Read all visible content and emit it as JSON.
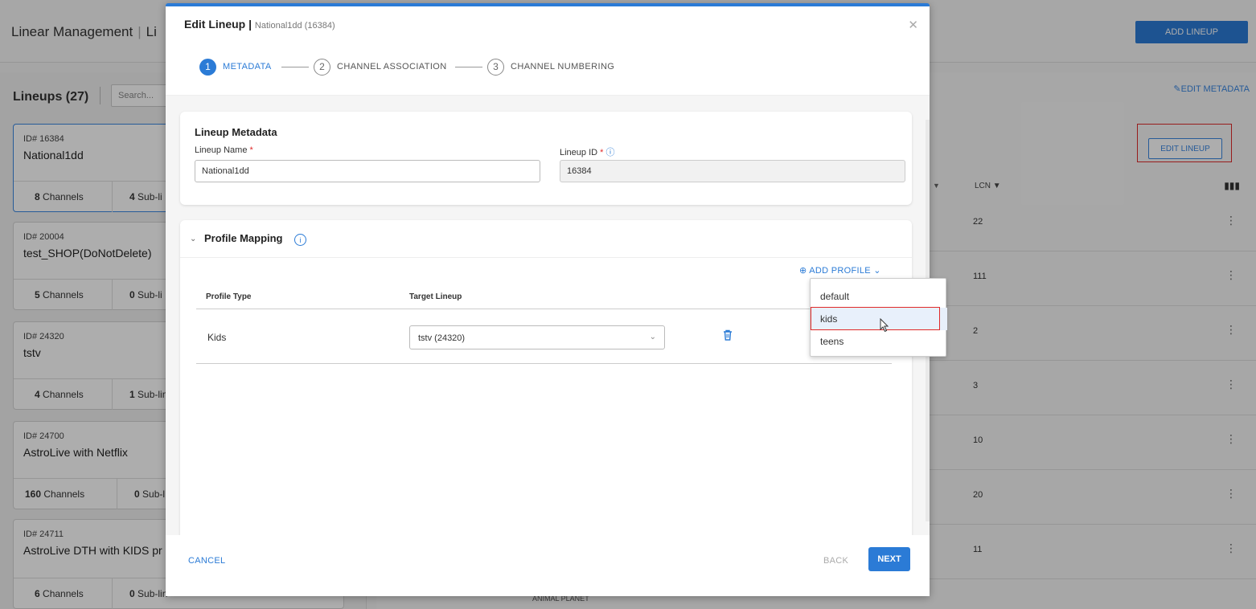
{
  "app": {
    "title": "Linear Management",
    "title_partial": "Li",
    "add_lineup_label": "ADD LINEUP"
  },
  "sidebar": {
    "heading": "Lineups (27)",
    "search_placeholder": "Search...",
    "cards": [
      {
        "id_label": "ID# 16384",
        "name": "National1dd",
        "channels_count": "8",
        "channels_word": "Channels",
        "sub_count": "4",
        "sub_word": "Sub-li"
      },
      {
        "id_label": "ID# 20004",
        "name": "test_SHOP(DoNotDelete)",
        "channels_count": "5",
        "channels_word": "Channels",
        "sub_count": "0",
        "sub_word": "Sub-li"
      },
      {
        "id_label": "ID# 24320",
        "name": "tstv",
        "channels_count": "4",
        "channels_word": "Channels",
        "sub_count": "1",
        "sub_word": "Sub-lin"
      },
      {
        "id_label": "ID# 24700",
        "name": "AstroLive with Netflix",
        "channels_count": "160",
        "channels_word": "Channels",
        "sub_count": "0",
        "sub_word": "Sub-l"
      },
      {
        "id_label": "ID# 24711",
        "name": "AstroLive DTH with KIDS pr",
        "channels_count": "6",
        "channels_word": "Channels",
        "sub_count": "0",
        "sub_word": "Sub-lin"
      }
    ]
  },
  "details": {
    "edit_metadata_label": "EDIT METADATA",
    "edit_lineup_label": "EDIT LINEUP",
    "lcn_header": "LCN",
    "lcn_values": [
      "22",
      "111",
      "2",
      "3",
      "10",
      "20",
      "11"
    ],
    "partial_row_text": "ANIMAL PLANET"
  },
  "modal": {
    "title": "Edit Lineup",
    "subtitle": "National1dd (16384)",
    "steps": [
      {
        "num": "1",
        "label": "METADATA"
      },
      {
        "num": "2",
        "label": "CHANNEL ASSOCIATION"
      },
      {
        "num": "3",
        "label": "CHANNEL NUMBERING"
      }
    ],
    "metadata": {
      "heading": "Lineup Metadata",
      "name_label": "Lineup Name",
      "name_value": "National1dd",
      "id_label": "Lineup ID",
      "id_value": "16384"
    },
    "profile_mapping": {
      "heading": "Profile Mapping",
      "add_profile_label": "ADD PROFILE",
      "col_profile_type": "Profile Type",
      "col_target_lineup": "Target Lineup",
      "rows": [
        {
          "profile_type": "Kids",
          "target_lineup": "tstv (24320)"
        }
      ]
    },
    "footer": {
      "cancel_label": "CANCEL",
      "back_label": "BACK",
      "next_label": "NEXT"
    }
  },
  "profile_menu": {
    "options": [
      "default",
      "kids",
      "teens"
    ],
    "hovered": "kids"
  },
  "colors": {
    "accent": "#2b7bd6",
    "highlight_box": "#e02a2a"
  }
}
